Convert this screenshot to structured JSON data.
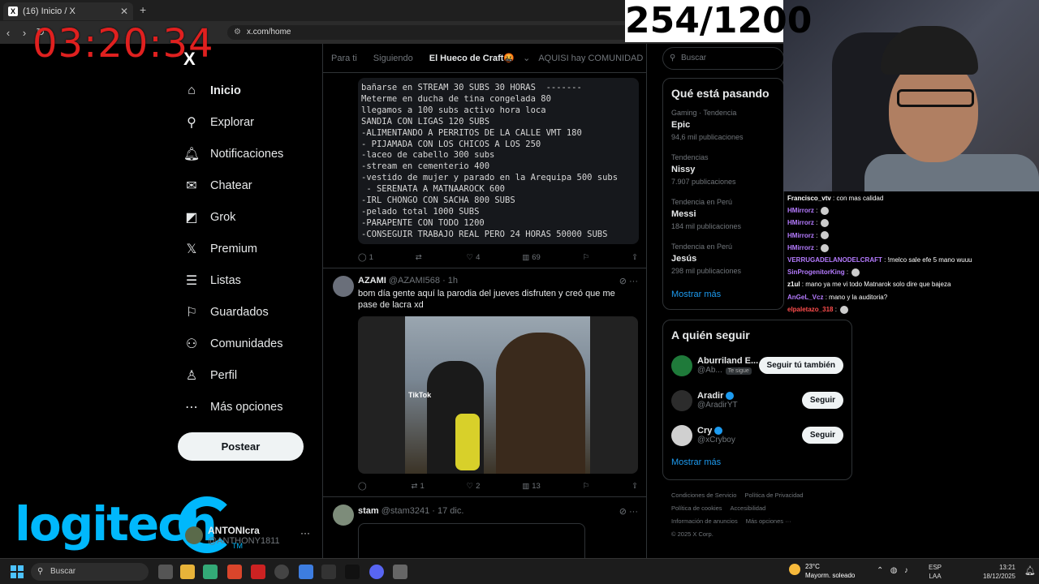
{
  "browser": {
    "tab_title": "(16) Inicio / X",
    "tab_favicon": "X",
    "url": "x.com/home"
  },
  "overlay": {
    "timer": "03:20:34",
    "sub_counter": "254/1200",
    "timer_color": "#e0201f"
  },
  "x_sidebar": {
    "logo": "X",
    "items": [
      {
        "label": "Inicio",
        "icon": "home-icon",
        "glyph": "⌂"
      },
      {
        "label": "Explorar",
        "icon": "search-icon",
        "glyph": "⚲"
      },
      {
        "label": "Notificaciones",
        "icon": "bell-icon",
        "glyph": "🔔︎",
        "badge": "16"
      },
      {
        "label": "Chatear",
        "icon": "mail-icon",
        "glyph": "✉"
      },
      {
        "label": "Grok",
        "icon": "grok-icon",
        "glyph": "◩"
      },
      {
        "label": "Premium",
        "icon": "x-premium-icon",
        "glyph": "𝕏"
      },
      {
        "label": "Listas",
        "icon": "list-icon",
        "glyph": "☰"
      },
      {
        "label": "Guardados",
        "icon": "bookmark-icon",
        "glyph": "⚐"
      },
      {
        "label": "Comunidades",
        "icon": "communities-icon",
        "glyph": "⚇"
      },
      {
        "label": "Perfil",
        "icon": "person-icon",
        "glyph": "♙"
      },
      {
        "label": "Más opciones",
        "icon": "more-options-icon",
        "glyph": "⋯"
      }
    ],
    "post_button": "Postear",
    "account": {
      "name": "ANTONIcra",
      "handle": "@ANTHONY1811",
      "more": "···"
    }
  },
  "brand_overlay": {
    "logitech": "logitech",
    "tm": "TM"
  },
  "timeline": {
    "tabs": [
      "Para ti",
      "Siguiendo",
      "El Hueco de Craft🤬",
      "AQUISI hay COMUNIDAD"
    ],
    "selected_tab": "El Hueco de Craft🤬",
    "tweet1": {
      "code_lines": [
        "bañarse en STREAM 30 SUBS 30 HORAS  -------",
        "Meterme en ducha de tina congelada 80",
        "llegamos a 100 subs activo hora loca",
        "SANDIA CON LIGAS 120 SUBS",
        "-ALIMENTANDO A PERRITOS DE LA CALLE VMT 180",
        "- PIJAMADA CON LOS CHICOS A LOS 250",
        "-laceo de cabello 300 subs",
        "-stream en cementerio 400",
        "-vestido de mujer y parado en la Arequipa 500 subs",
        " - SERENATA A MATNAAROCK 600",
        "-IRL CHONGO CON SACHA 800 SUBS",
        "-pelado total 1000 SUBS",
        "-PARAPENTE CON TODO 1200",
        "-CONSEGUIR TRABAJO REAL PERO 24 HORAS 50000 SUBS"
      ],
      "replies": "1",
      "reposts": "",
      "likes": "4",
      "views": "69"
    },
    "tweet2": {
      "name": "AZAMI",
      "handle": "@AZAMI568 · 1h",
      "text": "bom día gente aquí la parodia del jueves disfruten y creó que me pase de lacra xd",
      "media_watermark": "TikTok",
      "replies": "",
      "reposts": "1",
      "likes": "2",
      "views": "13"
    },
    "tweet3": {
      "name": "stam",
      "handle": "@stam3241 · 17 dic."
    }
  },
  "right": {
    "search_placeholder": "Buscar",
    "trends_title": "Qué está pasando",
    "trends": [
      {
        "meta": "Gaming · Tendencia",
        "title": "Epic",
        "count": "94,6 mil publicaciones"
      },
      {
        "meta": "Tendencias",
        "title": "Nissy",
        "count": "7.907 publicaciones"
      },
      {
        "meta": "Tendencia en Perú",
        "title": "Messi",
        "count": "184 mil publicaciones"
      },
      {
        "meta": "Tendencia en Perú",
        "title": "Jesús",
        "count": "298 mil publicaciones"
      }
    ],
    "trends_more": "Mostrar más",
    "follow_title": "A quién seguir",
    "follow": [
      {
        "name": "Aburriland E...",
        "handle": "@Ab...",
        "tag": "Te sigue",
        "button": "Seguir tú también",
        "verified": false
      },
      {
        "name": "Aradir",
        "handle": "@AradirYT",
        "tag": "",
        "button": "Seguir",
        "verified": true
      },
      {
        "name": "Cry",
        "handle": "@xCryboy",
        "tag": "",
        "button": "Seguir",
        "verified": true
      }
    ],
    "follow_more": "Mostrar más",
    "footer": [
      "Condiciones de Servicio",
      "Política de Privacidad",
      "Política de cookies",
      "Accesibilidad",
      "Información de anuncios",
      "Más opciones ···",
      "© 2025 X Corp."
    ]
  },
  "chat": [
    {
      "user": "Francisco_vtv",
      "text": ": con mas calidad",
      "color": "#ffffff"
    },
    {
      "user": "HMirrorz",
      "text": ":",
      "color": "#b57bff",
      "emote": true
    },
    {
      "user": "HMirrorz",
      "text": ":",
      "color": "#b57bff",
      "emote": true
    },
    {
      "user": "HMirrorz",
      "text": ":",
      "color": "#b57bff",
      "emote": true
    },
    {
      "user": "HMirrorz",
      "text": ":",
      "color": "#b57bff",
      "emote": true
    },
    {
      "user": "VERRUGADELANODELCRAFT",
      "text": ": !melco sale efe 5 mano wuuu",
      "color": "#b57bff"
    },
    {
      "user": "SinProgenitorKing",
      "text": ":",
      "color": "#b57bff",
      "emote": true
    },
    {
      "user": "z1ul",
      "text": ": mano ya me vi todo Matnarok solo dire que bajeza",
      "color": "#ffffff"
    },
    {
      "user": "AnGeL_Vcz",
      "text": ": mano y la auditoria?",
      "color": "#b57bff"
    },
    {
      "user": "elpaletazo_318",
      "text": ":",
      "color": "#ff4d4d",
      "emote": true
    }
  ],
  "taskbar": {
    "search_placeholder": "Buscar",
    "weather_temp": "23°C",
    "weather_desc": "Mayorm. soleado",
    "lang_top": "ESP",
    "lang_bottom": "LAA",
    "time": "13:21",
    "date": "18/12/2025"
  }
}
